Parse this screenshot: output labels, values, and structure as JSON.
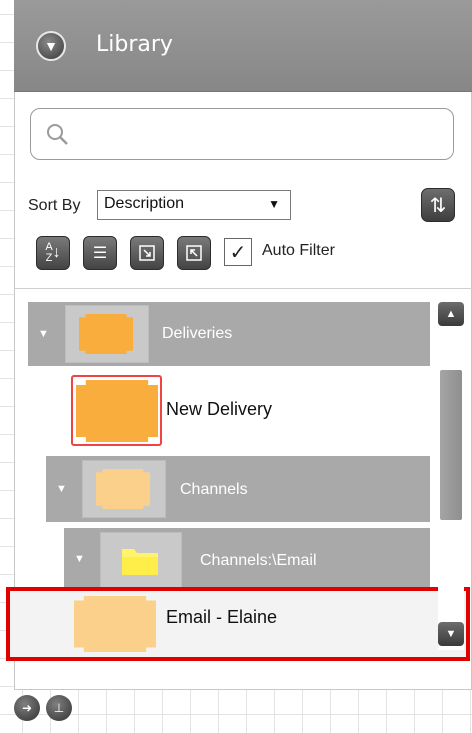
{
  "library": {
    "title": "Library",
    "collapse_icon": "chevron-down-circle-icon"
  },
  "search": {
    "placeholder": "",
    "value": "",
    "icon": "search-icon"
  },
  "sort": {
    "label": "Sort By",
    "selected": "Description",
    "refresh_icon": "refresh-icon"
  },
  "toolbar": {
    "buttons": [
      {
        "icon": "sort-az-icon",
        "glyph": "A↓"
      },
      {
        "icon": "list-collapse-icon",
        "glyph": "☰"
      },
      {
        "icon": "expand-icon",
        "glyph": "⧉"
      },
      {
        "icon": "collapse-icon",
        "glyph": "⧉"
      }
    ],
    "auto_filter_label": "Auto Filter",
    "auto_filter_checked": true
  },
  "tree": {
    "deliveries_label": "Deliveries",
    "new_delivery_label": "New Delivery",
    "channels_label": "Channels",
    "channels_email_label": "Channels:\\Email",
    "email_elaine_label": "Email - Elaine"
  },
  "colors": {
    "header_gray": "#8f8f8f",
    "row_gray": "#a9a9a9",
    "orange": "#f9ad3c",
    "light_orange": "#fbd08a",
    "highlight_red": "#e00000"
  }
}
